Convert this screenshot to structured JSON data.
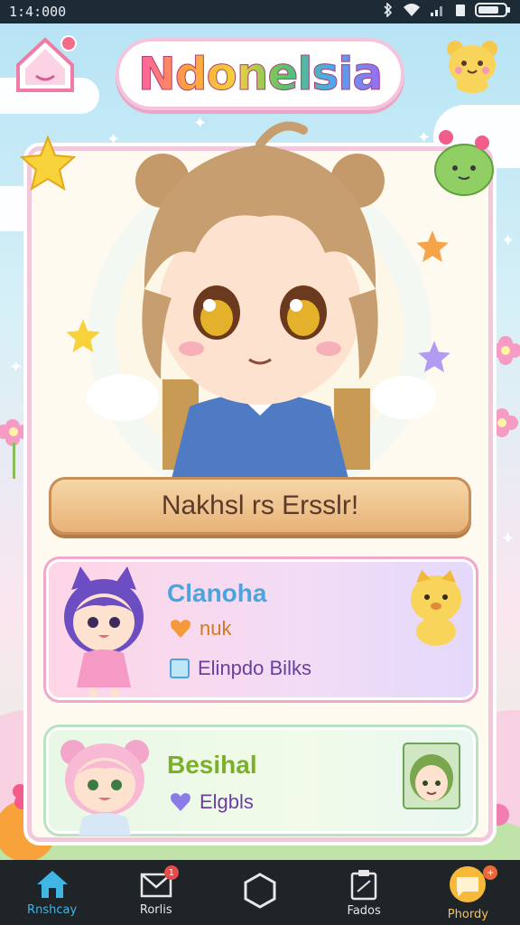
{
  "status": {
    "time": "1:4:000"
  },
  "header": {
    "title": "Ndonelsia"
  },
  "hero": {
    "headline": "Nakhsl rs Ersslr!"
  },
  "profiles": [
    {
      "name": "Clanoha",
      "row1": "nuk",
      "row2": "Elinpdo Bilks"
    },
    {
      "name": "Besihal",
      "row1": "Elgbls"
    }
  ],
  "nav": [
    {
      "label": "Rnshcay",
      "icon": "home-icon"
    },
    {
      "label": "Rorlis",
      "icon": "inbox-icon",
      "badge": "1"
    },
    {
      "label": "",
      "icon": "hexagon-icon"
    },
    {
      "label": "Fados",
      "icon": "clipboard-icon"
    },
    {
      "label": "Phordy",
      "icon": "chat-bubble-icon",
      "badge": "+"
    }
  ],
  "colors": {
    "accent_pink": "#f3c8dc",
    "accent_blue": "#3fb6e4",
    "name_blue": "#4aa4e0",
    "name_green": "#7db02a"
  }
}
